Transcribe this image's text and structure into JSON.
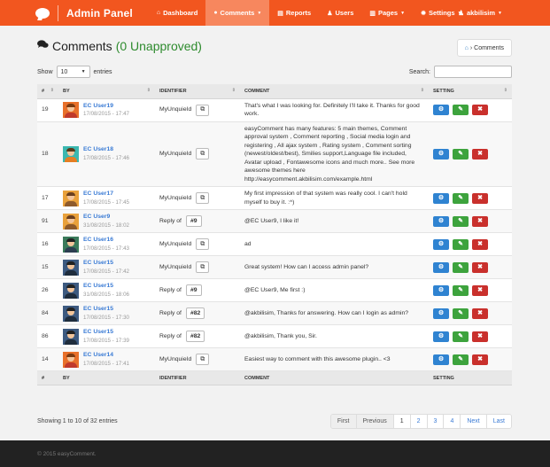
{
  "nav": {
    "brand": "Admin Panel",
    "items": [
      {
        "icon": "⌂",
        "label": "Dashboard",
        "active": false
      },
      {
        "icon": "●",
        "label": "Comments",
        "active": true,
        "caret": "▼"
      },
      {
        "icon": "▤",
        "label": "Reports",
        "active": false
      },
      {
        "icon": "♟",
        "label": "Users",
        "active": false
      },
      {
        "icon": "▥",
        "label": "Pages",
        "active": false,
        "caret": "▼"
      },
      {
        "icon": "✹",
        "label": "Settings",
        "active": false,
        "caret": "▼"
      }
    ],
    "user": "akbilisim",
    "user_icon": "♟",
    "user_caret": "▼"
  },
  "header": {
    "title": "Comments",
    "unapproved": "(0 Unapproved)",
    "breadcrumb": "Comments"
  },
  "controls": {
    "show_label": "Show",
    "show_value": "10",
    "entries_label": "entries",
    "search_label": "Search:"
  },
  "table": {
    "columns": [
      "#",
      "BY",
      "IDENTIFIER",
      "COMMENT",
      "SETTING"
    ],
    "rows": [
      {
        "id": "19",
        "user": "EC User19",
        "date": "17/08/2015 - 17:47",
        "identifier": "MyUnquieId",
        "reply": false,
        "comment": "That's what I was looking for. Definitely I'll take it. Thanks for good work.",
        "avatar": "orange"
      },
      {
        "id": "18",
        "user": "EC User18",
        "date": "17/08/2015 - 17:46",
        "identifier": "MyUnquieId",
        "reply": false,
        "comment": "easyComment has many features: 5 main themes, Comment approval system , Comment reporting , Social media login and registering , All ajax system , Rating system , Comment sorting (newest/oldest/best), Smilies support,Language file included, Avatar upload , Fontawesome icons and much more.. See more awesome themes here http://easycomment.akbilisim.com/example.html",
        "avatar": "teal"
      },
      {
        "id": "17",
        "user": "EC User17",
        "date": "17/08/2015 - 17:45",
        "identifier": "MyUnquieId",
        "reply": false,
        "comment": "My first impression of that system was really cool. I can't hold myself to buy it. :^)",
        "avatar": "brown"
      },
      {
        "id": "91",
        "user": "EC User9",
        "date": "31/08/2015 - 18:02",
        "identifier": "Reply of",
        "reply": true,
        "reply_to": "#9",
        "comment": "@EC User9, I like it!",
        "avatar": "brown"
      },
      {
        "id": "16",
        "user": "EC User16",
        "date": "17/08/2015 - 17:43",
        "identifier": "MyUnquieId",
        "reply": false,
        "comment": "ad",
        "avatar": "green"
      },
      {
        "id": "15",
        "user": "EC User15",
        "date": "17/08/2015 - 17:42",
        "identifier": "MyUnquieId",
        "reply": false,
        "comment": "Great system! How can I access admin panel?",
        "avatar": "suit"
      },
      {
        "id": "26",
        "user": "EC User15",
        "date": "31/08/2015 - 18:06",
        "identifier": "Reply of",
        "reply": true,
        "reply_to": "#9",
        "comment": "@EC User9, Me first :)",
        "avatar": "suit"
      },
      {
        "id": "84",
        "user": "EC User15",
        "date": "17/08/2015 - 17:30",
        "identifier": "Reply of",
        "reply": true,
        "reply_to": "#82",
        "comment": "@akbilisim, Thanks for answering. How can I login as admin?",
        "avatar": "suit"
      },
      {
        "id": "86",
        "user": "EC User15",
        "date": "17/08/2015 - 17:39",
        "identifier": "Reply of",
        "reply": true,
        "reply_to": "#82",
        "comment": "@akbilisim, Thank you, Sir.",
        "avatar": "suit"
      },
      {
        "id": "14",
        "user": "EC User14",
        "date": "17/08/2015 - 17:41",
        "identifier": "MyUnquieId",
        "reply": false,
        "comment": "Easiest way to comment with this awesome plugin.. <3",
        "avatar": "orange"
      }
    ],
    "actions": {
      "settings": "⚙",
      "edit": "✎",
      "delete": "✖"
    },
    "external_icon": "⧉"
  },
  "info": "Showing 1 to 10 of 32 entries",
  "pagination": [
    "First",
    "Previous",
    "1",
    "2",
    "3",
    "4",
    "Next",
    "Last"
  ],
  "footer": "© 2015 easyComment.",
  "colors": {
    "nav": "#f2561f",
    "nav_active": "#f7875e",
    "link": "#3a7bd5",
    "approved": "#2e8b2e"
  }
}
